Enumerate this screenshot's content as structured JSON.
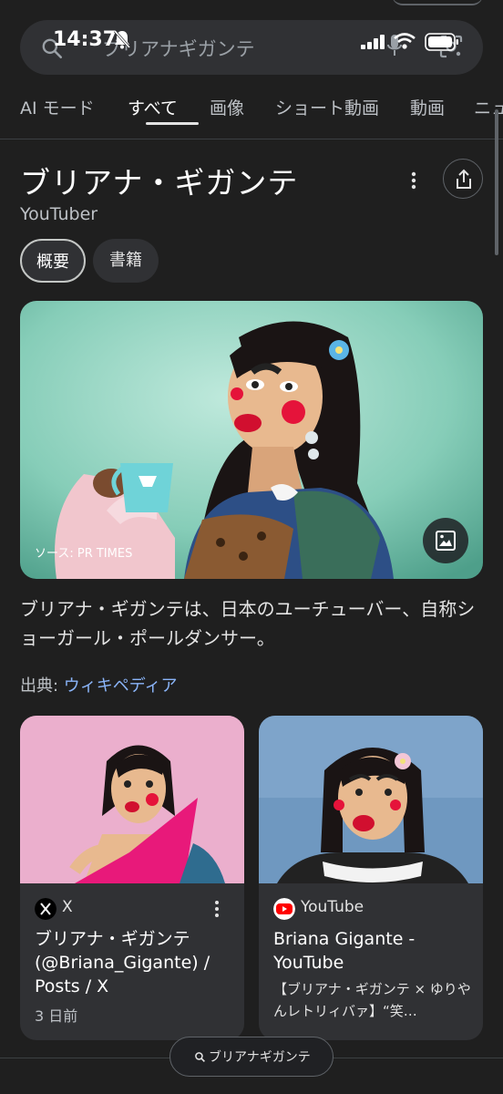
{
  "status": {
    "time": "14:37"
  },
  "search": {
    "query": "ブリアナギガンテ"
  },
  "tabs": [
    {
      "label": "AI モード"
    },
    {
      "label": "すべて"
    },
    {
      "label": "画像"
    },
    {
      "label": "ショート動画"
    },
    {
      "label": "動画"
    },
    {
      "label": "ニュ"
    }
  ],
  "knowledge_panel": {
    "title": "ブリアナ・ギガンテ",
    "subtitle": "YouTuber",
    "chips": [
      {
        "label": "概要"
      },
      {
        "label": "書籍"
      }
    ],
    "image_source": "ソース: PR TIMES",
    "description": "ブリアナ・ギガンテは、日本のユーチューバー、自称ショーガール・ポールダンサー。",
    "source_prefix": "出典: ",
    "source_link": "ウィキペディア"
  },
  "cards": [
    {
      "source_name": "X",
      "title": "ブリアナ・ギガンテ (@Briana_Gigante) / Posts / X",
      "date": "3 日前"
    },
    {
      "source_name": "YouTube",
      "title": "Briana Gigante - YouTube",
      "snippet": "【ブリアナ・ギガンテ × ゆりやんレトリィバァ】“笑…"
    }
  ],
  "floating_search": {
    "label": "ブリアナギガンテ"
  },
  "colors": {
    "background": "#1f1f1f",
    "card": "#303134",
    "link": "#8ab4f8",
    "youtube_red": "#ff0000"
  }
}
